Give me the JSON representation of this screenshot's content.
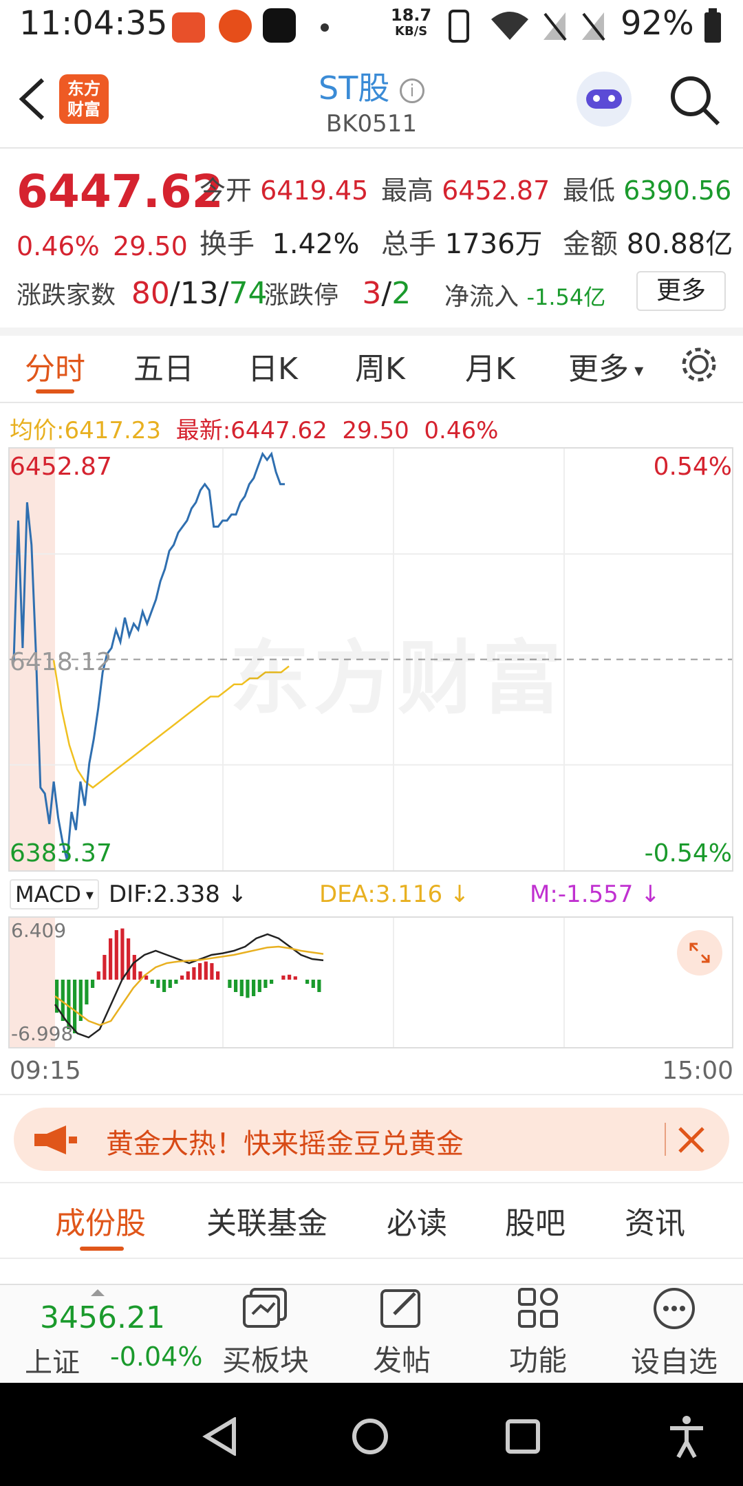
{
  "status_bar": {
    "time": "11:04:35",
    "net_speed_top": "18.7",
    "net_speed_bottom": "KB/S",
    "battery": "92%"
  },
  "header": {
    "title": "ST股",
    "code": "BK0511",
    "brand": "东方\n财富"
  },
  "quote": {
    "price": "6447.62",
    "change_pct": "0.46%",
    "change_abs": "29.50",
    "open_label": "今开",
    "open": "6419.45",
    "high_label": "最高",
    "high": "6452.87",
    "low_label": "最低",
    "low": "6390.56",
    "turnover_label": "换手",
    "turnover": "1.42%",
    "volume_label": "总手",
    "volume": "1736万",
    "amount_label": "金额",
    "amount": "80.88亿",
    "breadth_label": "涨跌家数",
    "up_count": "80",
    "flat_count": "13",
    "down_count": "74",
    "limit_label": "涨跌停",
    "limit_up": "3",
    "limit_down": "2",
    "inflow_label": "净流入",
    "inflow": "-1.54亿",
    "more_button": "更多"
  },
  "chart_tabs": [
    "分时",
    "五日",
    "日K",
    "周K",
    "月K",
    "更多"
  ],
  "legend": {
    "avg_label": "均价:",
    "avg_value": "6417.23",
    "latest_label": "最新:",
    "latest_value": "6447.62",
    "latest_change": "29.50",
    "latest_pct": "0.46%"
  },
  "chart_labels": {
    "top_value": "6452.87",
    "mid_value": "6418.12",
    "bottom_value": "6383.37",
    "top_pct": "0.54%",
    "bottom_pct": "-0.54%",
    "watermark": "东方财富",
    "time_start": "09:15",
    "time_end": "15:00"
  },
  "macd": {
    "selector": "MACD",
    "dif": "DIF:2.338",
    "dea": "DEA:3.116",
    "m": "M:-1.557",
    "top": "6.409",
    "bottom": "-6.998"
  },
  "banner": {
    "text": "黄金大热！快来摇金豆兑黄金"
  },
  "bottom_tabs": [
    "成份股",
    "关联基金",
    "必读",
    "股吧",
    "资讯"
  ],
  "bottom_nav": {
    "index_value": "3456.21",
    "index_name": "上证",
    "index_change": "-0.04%",
    "buttons": [
      "买板块",
      "发帖",
      "功能",
      "设自选"
    ]
  },
  "colors": {
    "red": "#d5232f",
    "green": "#1a9a2c",
    "accent": "#e0561a",
    "blue": "#3a8bd6",
    "avg_line": "#f0c020"
  },
  "chart_data": {
    "type": "line",
    "ylim": [
      6383.37,
      6452.87
    ],
    "reference": 6418.12,
    "series": [
      {
        "values": [
          6418,
          6441,
          6420,
          6444,
          6437,
          6419,
          6397,
          6396,
          6391,
          6398,
          6392,
          6388,
          6385,
          6393,
          6390,
          6398,
          6394,
          6401,
          6405,
          6410,
          6416,
          6419,
          6420,
          6423,
          6421,
          6425,
          6422,
          6424,
          6423,
          6426,
          6424,
          6426,
          6428,
          6431,
          6433,
          6436,
          6437,
          6439,
          6440,
          6441,
          6443,
          6444,
          6446,
          6447,
          6446,
          6440,
          6440,
          6441,
          6441,
          6442,
          6442,
          6444,
          6445,
          6447,
          6448,
          6450,
          6452,
          6451,
          6452,
          6449,
          6447,
          6447
        ]
      },
      {
        "values": [
          6418,
          6410,
          6404,
          6400,
          6398,
          6397,
          6398,
          6399,
          6400,
          6401,
          6402,
          6403,
          6404,
          6405,
          6406,
          6407,
          6408,
          6409,
          6410,
          6411,
          6412,
          6412,
          6413,
          6414,
          6414,
          6415,
          6415,
          6416,
          6416,
          6416,
          6417
        ]
      }
    ],
    "macd_hist": [
      -4,
      -5,
      -6,
      -6.5,
      -5,
      -3,
      -1,
      1,
      3,
      5,
      6,
      6.2,
      5,
      3,
      1,
      0.5,
      -0.5,
      -1,
      -1.5,
      -1,
      -0.5,
      0.5,
      1,
      1.5,
      2,
      2.2,
      2,
      1,
      0,
      -1,
      -1.5,
      -2,
      -2.2,
      -2,
      -1.5,
      -1,
      -0.5,
      0,
      0.5,
      0.6,
      0.4,
      0,
      -0.5,
      -1,
      -1.5
    ],
    "macd_dif": [
      -3,
      -5,
      -6.5,
      -7,
      -6,
      -3,
      0,
      2,
      3,
      3.5,
      3,
      2.5,
      2,
      2.5,
      3,
      3.2,
      3.5,
      4,
      5,
      5.5,
      5,
      4,
      3,
      2.5,
      2.338
    ],
    "macd_dea": [
      -2,
      -3,
      -4,
      -5,
      -5.5,
      -5,
      -3,
      -1,
      0.5,
      1.5,
      2,
      2.2,
      2.3,
      2.4,
      2.6,
      2.8,
      3,
      3.3,
      3.6,
      3.9,
      4,
      3.8,
      3.5,
      3.3,
      3.116
    ]
  }
}
